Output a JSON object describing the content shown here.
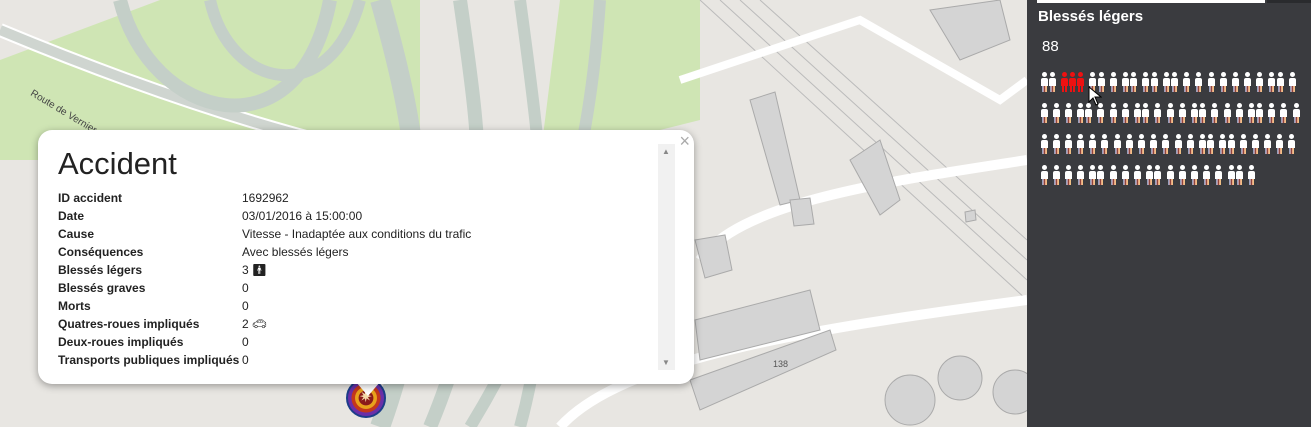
{
  "map": {
    "road_label": "Route de Vernier",
    "building_number": "138"
  },
  "popup": {
    "title": "Accident",
    "close_label": "×",
    "rows": [
      {
        "label": "ID accident",
        "value": "1692962"
      },
      {
        "label": "Date",
        "value": "03/01/2016 à 15:00:00"
      },
      {
        "label": "Cause",
        "value": "Vitesse - Inadaptée aux conditions du trafic"
      },
      {
        "label": "Conséquences",
        "value": "Avec blessés légers"
      },
      {
        "label": "Blessés légers",
        "value": "3",
        "icon": "person-icon",
        "icon_count": 3
      },
      {
        "label": "Blessés graves",
        "value": "0"
      },
      {
        "label": "Morts",
        "value": "0"
      },
      {
        "label": "Quatres-roues impliqués",
        "value": "2",
        "icon": "car-icon",
        "icon_count": 2
      },
      {
        "label": "Deux-roues impliqués",
        "value": "0"
      },
      {
        "label": "Transports publiques impliqués",
        "value": "0"
      }
    ]
  },
  "panel": {
    "title": "Blessés légers",
    "count": "88",
    "highlight_color": "#e11111",
    "highlighted_people": 3
  }
}
